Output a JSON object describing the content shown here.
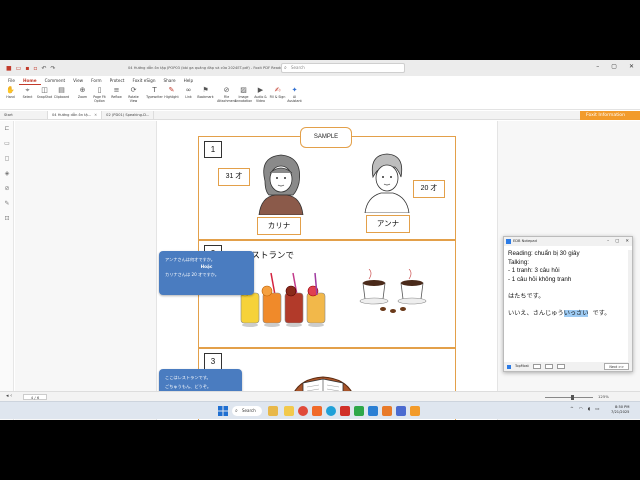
{
  "window": {
    "title": "04 Hướng dẫn ôn tập JPOP03 (bài ga quảng đáp và cửa 2024ET.pdf) - Foxit PDF Reader",
    "search_placeholder": "Search"
  },
  "menu": [
    "File",
    "Home",
    "Comment",
    "View",
    "Form",
    "Protect",
    "Foxit eSign",
    "Share",
    "Help"
  ],
  "menu_active": "Home",
  "ribbon": [
    {
      "label": "Hand",
      "icon": "hand-icon"
    },
    {
      "label": "Select",
      "icon": "cursor-icon"
    },
    {
      "label": "SnapShot",
      "icon": "camera-icon"
    },
    {
      "label": "Clipboard",
      "icon": "clipboard-icon"
    },
    {
      "label": "Zoom",
      "icon": "zoom-icon"
    },
    {
      "label": "Page Fit Option",
      "icon": "page-fit-icon"
    },
    {
      "label": "Reflow",
      "icon": "reflow-icon"
    },
    {
      "label": "Rotate View",
      "icon": "rotate-icon"
    },
    {
      "label": "Typewriter",
      "icon": "typewriter-icon"
    },
    {
      "label": "Highlight",
      "icon": "highlight-icon"
    },
    {
      "label": "Link",
      "icon": "link-icon"
    },
    {
      "label": "Bookmark",
      "icon": "bookmark-icon"
    },
    {
      "label": "File Attachment",
      "icon": "attachment-icon"
    },
    {
      "label": "Image Annotation",
      "icon": "image-icon"
    },
    {
      "label": "Audio & Video",
      "icon": "video-icon"
    },
    {
      "label": "Fill & Sign",
      "icon": "sign-icon"
    },
    {
      "label": "AI Assistant",
      "icon": "ai-icon"
    }
  ],
  "foxit_info": "Foxit Information",
  "tabs": [
    {
      "label": "Start"
    },
    {
      "label": "04 Hướng dẫn ôn tậ..."
    },
    {
      "label": "02 (PD01) Speaking-D..."
    }
  ],
  "document": {
    "sample_label": "SAMPLE",
    "sections": [
      {
        "number": "1",
        "age_left": "31 才",
        "age_right": "20 才",
        "name_left": "カリナ",
        "name_right": "アンナ"
      },
      {
        "number": "2",
        "caption": "レストランで"
      },
      {
        "number": "3"
      }
    ],
    "callout1": {
      "line1": "アンナさんは何才ですか。",
      "line2": "Hoặc",
      "line3": "カリナさんは 20 才ですか。"
    },
    "callout2": {
      "line1": "ここはレストランです。",
      "line2": "ごちゅうもん、どうぞ。"
    }
  },
  "notepad": {
    "title": "EDB Notepad",
    "lines": [
      "Reading: chuẩn bị 30 giây",
      "Talking:",
      "- 1 tranh: 3 câu hỏi",
      "- 1 câu hỏi không tranh",
      "",
      "はたちです。",
      "",
      "いいえ、さんじゅう",
      "いっさい",
      "です。"
    ],
    "topmost_label": "TopMost",
    "next_label": "Next >>"
  },
  "status": {
    "page": "4 / 6",
    "zoom": "125%"
  },
  "taskbar": {
    "search": "Search",
    "time": "8:50 PM",
    "date": "7/21/2025"
  }
}
